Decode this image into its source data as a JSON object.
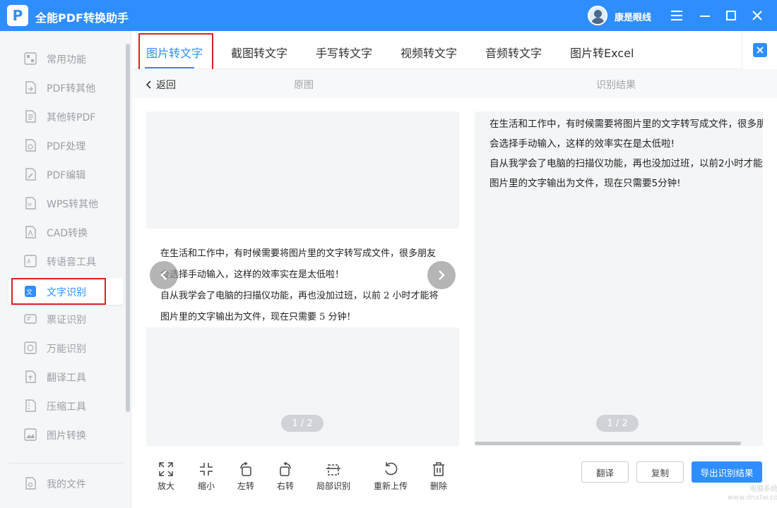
{
  "app": {
    "title": "全能PDF转换助手",
    "username": "康是眼线",
    "accent": "#2f8eff"
  },
  "sidebar": {
    "items": [
      {
        "label": "常用功能",
        "icon": "common-functions-icon"
      },
      {
        "label": "PDF转其他",
        "icon": "pdf-convert-icon"
      },
      {
        "label": "其他转PDF",
        "icon": "to-pdf-icon"
      },
      {
        "label": "PDF处理",
        "icon": "pdf-process-icon"
      },
      {
        "label": "PDF编辑",
        "icon": "pdf-edit-icon"
      },
      {
        "label": "WPS转其他",
        "icon": "wps-convert-icon"
      },
      {
        "label": "CAD转换",
        "icon": "cad-convert-icon"
      },
      {
        "label": "转语音工具",
        "icon": "text-to-speech-icon"
      },
      {
        "label": "文字识别",
        "icon": "ocr-icon",
        "active": true
      },
      {
        "label": "票证识别",
        "icon": "ticket-ocr-icon"
      },
      {
        "label": "万能识别",
        "icon": "universal-ocr-icon"
      },
      {
        "label": "翻译工具",
        "icon": "translate-icon"
      },
      {
        "label": "压缩工具",
        "icon": "compress-icon"
      },
      {
        "label": "图片转换",
        "icon": "image-convert-icon"
      }
    ],
    "my_files": "我的文件"
  },
  "tabs": [
    "图片转文字",
    "截图转文字",
    "手写转文字",
    "视频转文字",
    "音频转文字",
    "图片转Excel"
  ],
  "subheader": {
    "back": "返回",
    "original": "原图",
    "result": "识别结果"
  },
  "original_image": {
    "lines": [
      "在生活和工作中，有时候需要将图片里的文字转写成文件，很多朋友",
      "会选择手动输入，这样的效率实在是太低啦！",
      "自从我学会了电脑的扫描仪功能，再也没加过班，以前 2 小时才能将",
      "图片里的文字输出为文件，现在只需要 5 分钟！"
    ],
    "pager": "1 / 2"
  },
  "result": {
    "lines": [
      "在生活和工作中，有时候需要将图片里的文字转写成文件，很多朋友",
      "会选择手动输入，这样的效率实在是太低啦!",
      "自从我学会了电脑的扫描仪功能，再也没加过班，以前2小时才能将",
      "图片里的文字输出为文件，现在只需要5分钟!"
    ],
    "pager": "1 / 2"
  },
  "toolbar": {
    "zoom_in": "放大",
    "zoom_out": "缩小",
    "rotate_left": "左转",
    "rotate_right": "右转",
    "partial": "局部识别",
    "reupload": "重新上传",
    "delete": "删除"
  },
  "actions": {
    "translate": "翻译",
    "copy": "复制",
    "export": "导出识别结果"
  },
  "watermark": {
    "line1": "电脑系统网",
    "line2": "www.dnxtw.com"
  }
}
